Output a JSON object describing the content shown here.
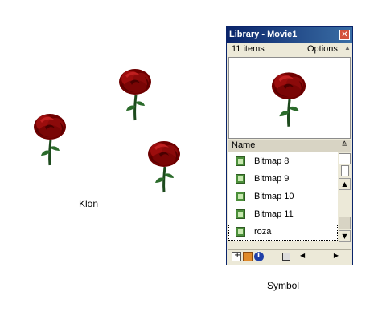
{
  "stage": {
    "caption_left": "Klon",
    "caption_right": "Symbol"
  },
  "library": {
    "title": "Library - Movie1",
    "close_glyph": "✕",
    "item_count": "11 items",
    "options_label": "Options",
    "options_arrow": "▲",
    "column_header": "Name",
    "sort_glyph": "≙",
    "items": [
      {
        "label": "Bitmap 8",
        "icon": "bitmap-icon"
      },
      {
        "label": "Bitmap 9",
        "icon": "bitmap-icon"
      },
      {
        "label": "Bitmap 10",
        "icon": "bitmap-icon"
      },
      {
        "label": "Bitmap 11",
        "icon": "bitmap-icon"
      },
      {
        "label": "roza",
        "icon": "bitmap-icon",
        "selected": true
      }
    ],
    "scroll_up_glyph": "▲",
    "scroll_down_glyph": "▼",
    "hscroll_left_glyph": "◀",
    "hscroll_right_glyph": "▶",
    "info_glyph": "i",
    "trash_glyph": "🗑"
  },
  "colors": {
    "titlebar": "#0a246a",
    "rose_red": "#8b0000",
    "stem_green": "#1d5a1d"
  }
}
